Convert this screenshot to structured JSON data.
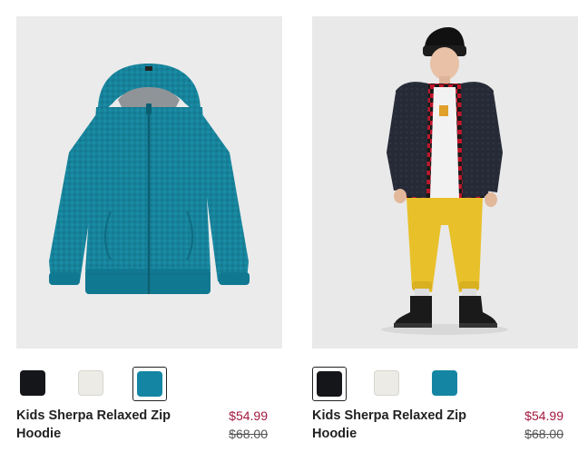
{
  "products": [
    {
      "name": "Kids Sherpa Relaxed Zip Hoodie",
      "sale_price": "$54.99",
      "original_price": "$68.00",
      "image_icon": "teal-sherpa-hoodie-photo",
      "swatches": [
        {
          "color": "#15161a",
          "label": "black",
          "selected": false
        },
        {
          "color": "#ecebe6",
          "label": "cream",
          "selected": false
        },
        {
          "color": "#1486a3",
          "label": "teal",
          "selected": true
        }
      ]
    },
    {
      "name": "Kids Sherpa Relaxed Zip Hoodie",
      "sale_price": "$54.99",
      "original_price": "$68.00",
      "image_icon": "model-wearing-black-hoodie-photo",
      "swatches": [
        {
          "color": "#15161a",
          "label": "black",
          "selected": true
        },
        {
          "color": "#ecebe6",
          "label": "cream",
          "selected": false
        },
        {
          "color": "#1486a3",
          "label": "teal",
          "selected": false
        }
      ]
    }
  ],
  "colors": {
    "sale": "#a3183f",
    "text": "#222222",
    "image_bg": "#ebebeb"
  }
}
